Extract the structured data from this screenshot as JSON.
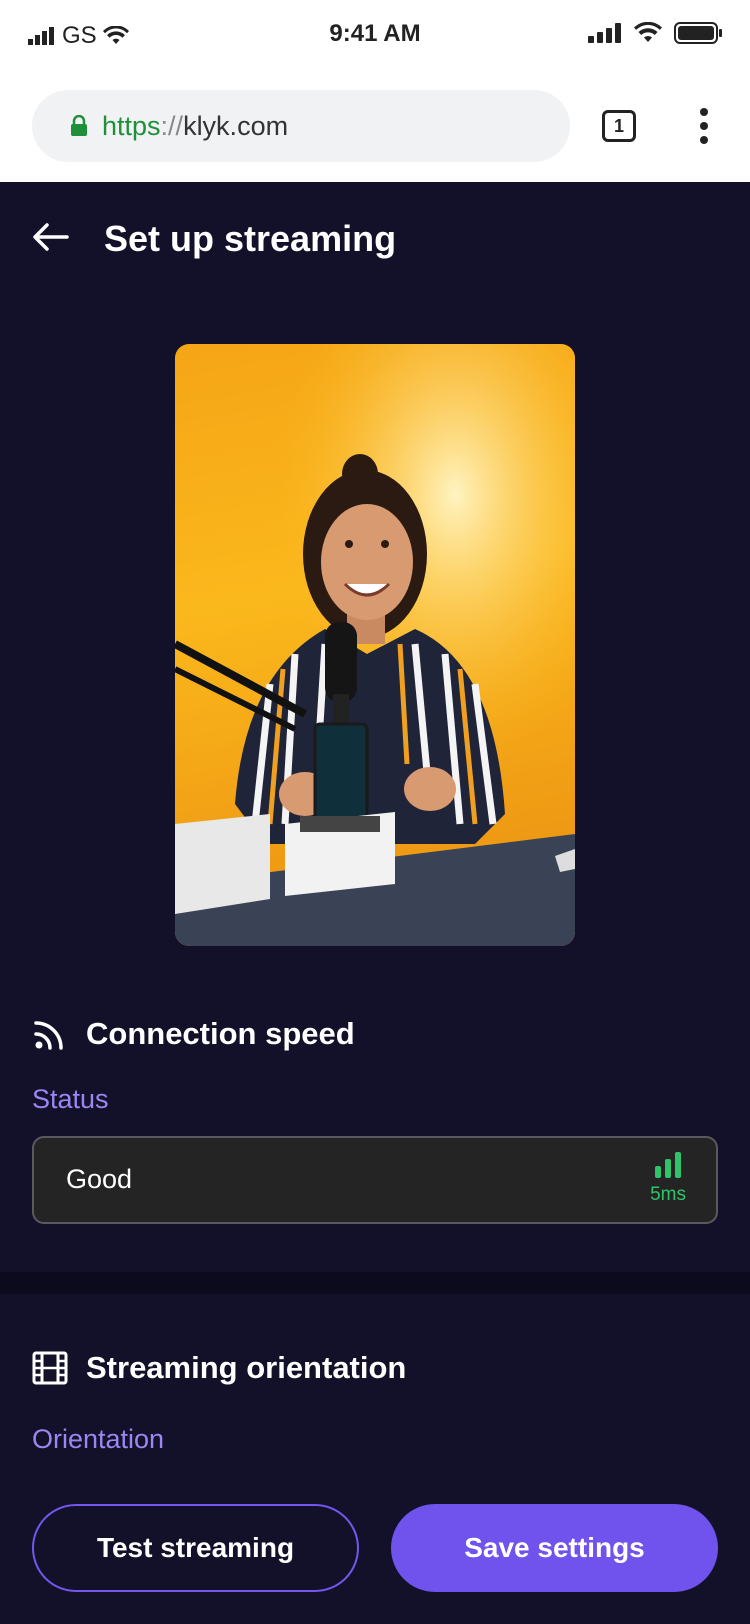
{
  "status_bar": {
    "carrier": "GS",
    "time": "9:41 AM"
  },
  "browser": {
    "url_scheme": "https",
    "url_sep": "://",
    "url_host": "klyk.com",
    "tab_count": "1"
  },
  "header": {
    "title": "Set up streaming"
  },
  "preview": {
    "icon": "camera-preview-image"
  },
  "connection": {
    "title": "Connection speed",
    "status_label": "Status",
    "status_value": "Good",
    "latency": "5ms",
    "signal_color": "#2fc36a"
  },
  "orientation": {
    "title": "Streaming orientation",
    "label": "Orientation"
  },
  "actions": {
    "test_label": "Test streaming",
    "save_label": "Save settings"
  },
  "colors": {
    "background": "#13102a",
    "accent": "#7052ec",
    "label": "#9b86f2"
  }
}
